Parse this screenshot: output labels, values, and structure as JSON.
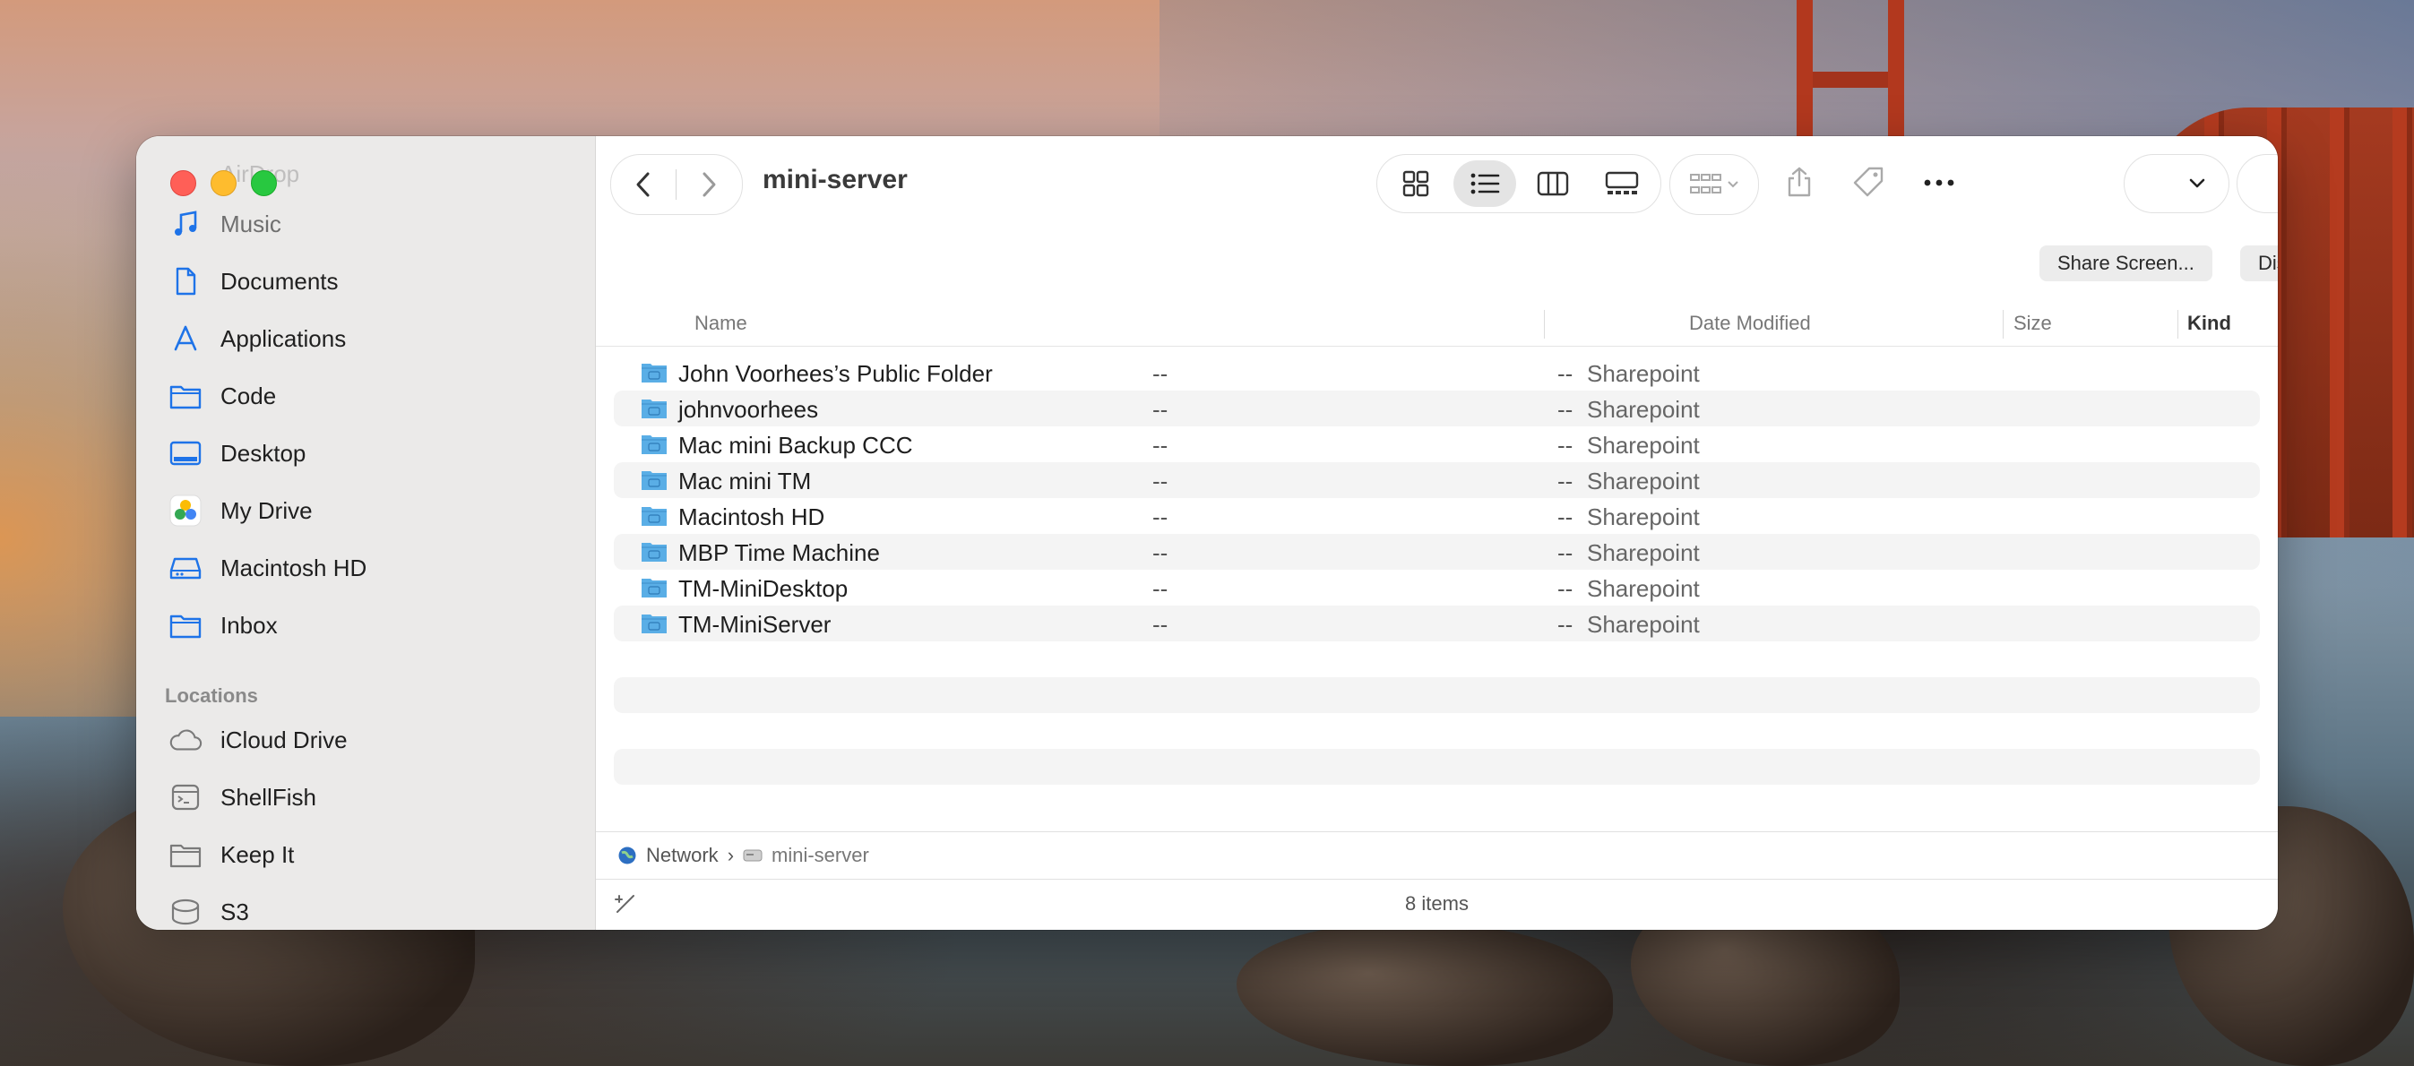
{
  "window": {
    "title": "mini-server",
    "share_screen_label": "Share Screen...",
    "disconnect_label": "Disconnect",
    "item_count": "8 items"
  },
  "sidebar": {
    "partial_top_label": "AirDrop",
    "favorites": [
      {
        "label": "Music",
        "icon": "music-note-icon"
      },
      {
        "label": "Documents",
        "icon": "document-icon"
      },
      {
        "label": "Applications",
        "icon": "applications-icon"
      },
      {
        "label": "Code",
        "icon": "folder-icon"
      },
      {
        "label": "Desktop",
        "icon": "desktop-icon"
      },
      {
        "label": "My Drive",
        "icon": "google-drive-icon"
      },
      {
        "label": "Macintosh HD",
        "icon": "hard-drive-icon"
      },
      {
        "label": "Inbox",
        "icon": "folder-icon"
      }
    ],
    "locations_heading": "Locations",
    "locations": [
      {
        "label": "iCloud Drive",
        "icon": "cloud-icon"
      },
      {
        "label": "ShellFish",
        "icon": "terminal-icon"
      },
      {
        "label": "Keep It",
        "icon": "folder-icon"
      },
      {
        "label": "S3",
        "icon": "disk-icon"
      }
    ]
  },
  "columns": {
    "name": "Name",
    "date_modified": "Date Modified",
    "size": "Size",
    "kind": "Kind"
  },
  "files": [
    {
      "name": "John Voorhees’s Public Folder",
      "date": "--",
      "size": "--",
      "kind": "Sharepoint"
    },
    {
      "name": "johnvoorhees",
      "date": "--",
      "size": "--",
      "kind": "Sharepoint"
    },
    {
      "name": "Mac mini Backup CCC",
      "date": "--",
      "size": "--",
      "kind": "Sharepoint"
    },
    {
      "name": "Mac mini TM",
      "date": "--",
      "size": "--",
      "kind": "Sharepoint"
    },
    {
      "name": "Macintosh HD",
      "date": "--",
      "size": "--",
      "kind": "Sharepoint"
    },
    {
      "name": "MBP Time Machine",
      "date": "--",
      "size": "--",
      "kind": "Sharepoint"
    },
    {
      "name": "TM-MiniDesktop",
      "date": "--",
      "size": "--",
      "kind": "Sharepoint"
    },
    {
      "name": "TM-MiniServer",
      "date": "--",
      "size": "--",
      "kind": "Sharepoint"
    }
  ],
  "pathbar": {
    "segments": [
      "Network",
      "mini-server"
    ]
  },
  "colors": {
    "accent": "#1e73e8",
    "folder": "#5aaee6"
  }
}
